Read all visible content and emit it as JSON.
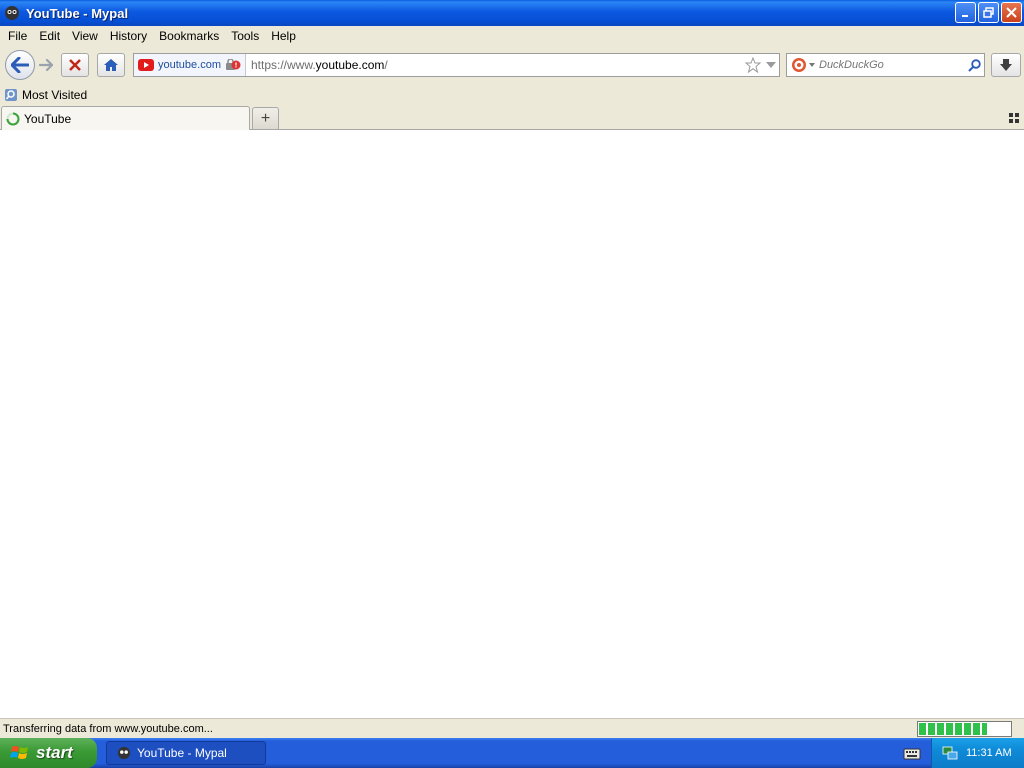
{
  "window": {
    "title": "YouTube - Mypal",
    "controls": [
      "minimize",
      "restore",
      "close"
    ]
  },
  "menubar": {
    "items": [
      "File",
      "Edit",
      "View",
      "History",
      "Bookmarks",
      "Tools",
      "Help"
    ]
  },
  "navbar": {
    "identity_label": "youtube.com",
    "url_prefix": "https://www.",
    "url_host": "youtube.com",
    "url_suffix": "/",
    "search_placeholder": "DuckDuckGo"
  },
  "bookmarks": {
    "items": [
      "Most Visited"
    ]
  },
  "tabs": {
    "items": [
      {
        "label": "YouTube"
      }
    ],
    "new_tab": "+"
  },
  "status": {
    "text": "Transferring data from www.youtube.com...",
    "progress": 0.75
  },
  "taskbar": {
    "start_label": "start",
    "task_item": "YouTube - Mypal",
    "clock": "11:31 AM"
  },
  "colors": {
    "titlebar": "#0a5fdc",
    "chrome": "#ece9d8",
    "taskbar": "#245edb",
    "start": "#3a9a35",
    "progress": "#2fc14a",
    "youtube": "#e21b1b"
  }
}
